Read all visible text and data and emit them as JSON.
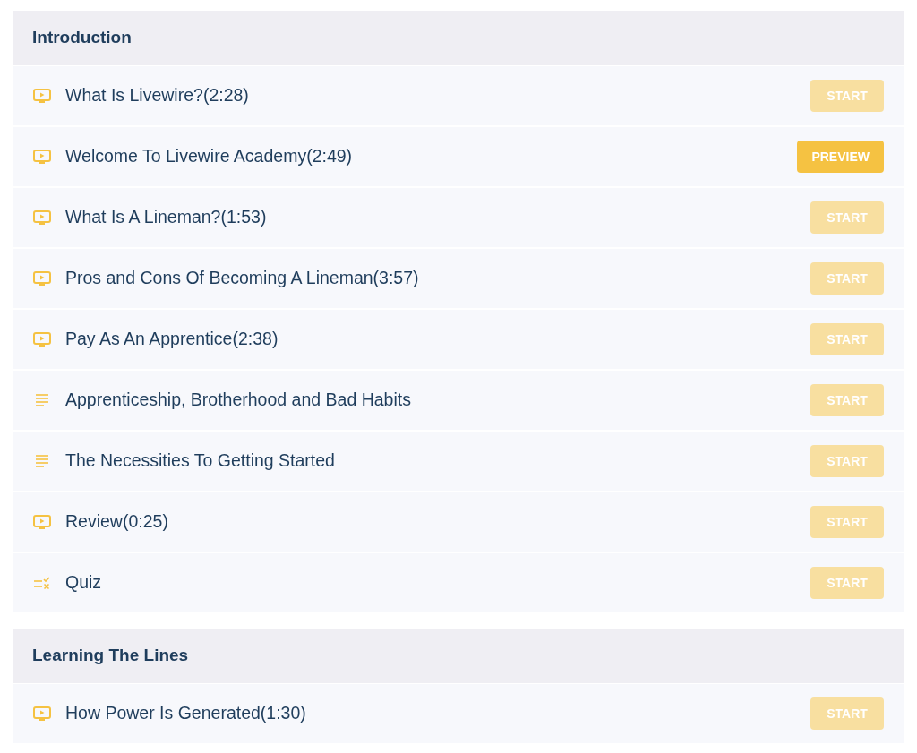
{
  "sections": [
    {
      "title": "Introduction",
      "lessons": [
        {
          "kind": "video",
          "title": "What Is Livewire?(2:28)",
          "button": {
            "label": "START",
            "disabled": true
          }
        },
        {
          "kind": "video",
          "title": "Welcome To Livewire Academy(2:49)",
          "button": {
            "label": "PREVIEW",
            "disabled": false
          }
        },
        {
          "kind": "video",
          "title": "What Is A Lineman?(1:53)",
          "button": {
            "label": "START",
            "disabled": true
          }
        },
        {
          "kind": "video",
          "title": "Pros and Cons Of Becoming A Lineman(3:57)",
          "button": {
            "label": "START",
            "disabled": true
          }
        },
        {
          "kind": "video",
          "title": "Pay As An Apprentice(2:38)",
          "button": {
            "label": "START",
            "disabled": true
          }
        },
        {
          "kind": "text",
          "title": "Apprenticeship, Brotherhood and Bad Habits",
          "button": {
            "label": "START",
            "disabled": true
          }
        },
        {
          "kind": "text",
          "title": "The Necessities To Getting Started",
          "button": {
            "label": "START",
            "disabled": true
          }
        },
        {
          "kind": "video",
          "title": "Review(0:25)",
          "button": {
            "label": "START",
            "disabled": true
          }
        },
        {
          "kind": "quiz",
          "title": "Quiz",
          "button": {
            "label": "START",
            "disabled": true
          }
        }
      ]
    },
    {
      "title": "Learning The Lines",
      "lessons": [
        {
          "kind": "video",
          "title": "How Power Is Generated(1:30)",
          "button": {
            "label": "START",
            "disabled": true
          }
        }
      ]
    }
  ]
}
